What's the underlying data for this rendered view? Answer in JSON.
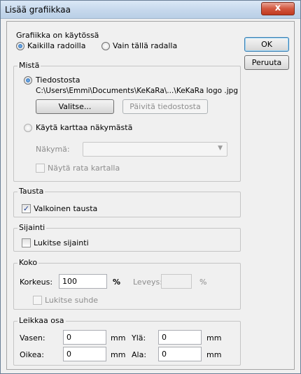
{
  "window": {
    "title": "Lisää grafiikkaa",
    "close_glyph": "x"
  },
  "buttons": {
    "ok": "OK",
    "cancel": "Peruuta"
  },
  "usage": {
    "label": "Grafiikka on käytössä",
    "all_courses": "Kaikilla radoilla",
    "this_course": "Vain tällä radalla",
    "selected": "all_courses"
  },
  "source": {
    "label": "Mistä",
    "from_file": "Tiedostosta",
    "file_path": "C:\\Users\\Emmi\\Documents\\KeKaRa\\...\\KeKaRa logo .jpg",
    "choose_button": "Valitse...",
    "refresh_button": "Päivitä tiedostosta",
    "use_map": "Käytä karttaa näkymästä",
    "view_label": "Näkymä:",
    "view_value": "",
    "show_course": "Näytä rata kartalla",
    "selected": "from_file"
  },
  "background": {
    "label": "Tausta",
    "white": "Valkoinen tausta",
    "white_checked": true
  },
  "position": {
    "label": "Sijainti",
    "lock": "Lukitse sijainti",
    "lock_checked": false
  },
  "size": {
    "label": "Koko",
    "height_label": "Korkeus:",
    "height_value": "100",
    "height_unit": "%",
    "width_label": "Leveys:",
    "width_value": "",
    "width_unit": "%",
    "lock_ratio": "Lukitse suhde",
    "lock_ratio_checked": false
  },
  "crop": {
    "label": "Leikkaa osa",
    "left_label": "Vasen:",
    "left_value": "0",
    "top_label": "Ylä:",
    "top_value": "0",
    "right_label": "Oikea:",
    "right_value": "0",
    "bottom_label": "Ala:",
    "bottom_value": "0",
    "unit": "mm"
  },
  "colors": {
    "checkmark": "#1f3f8f",
    "radio_dot": "#1a5ea8",
    "close_button": "#c13a1f"
  }
}
